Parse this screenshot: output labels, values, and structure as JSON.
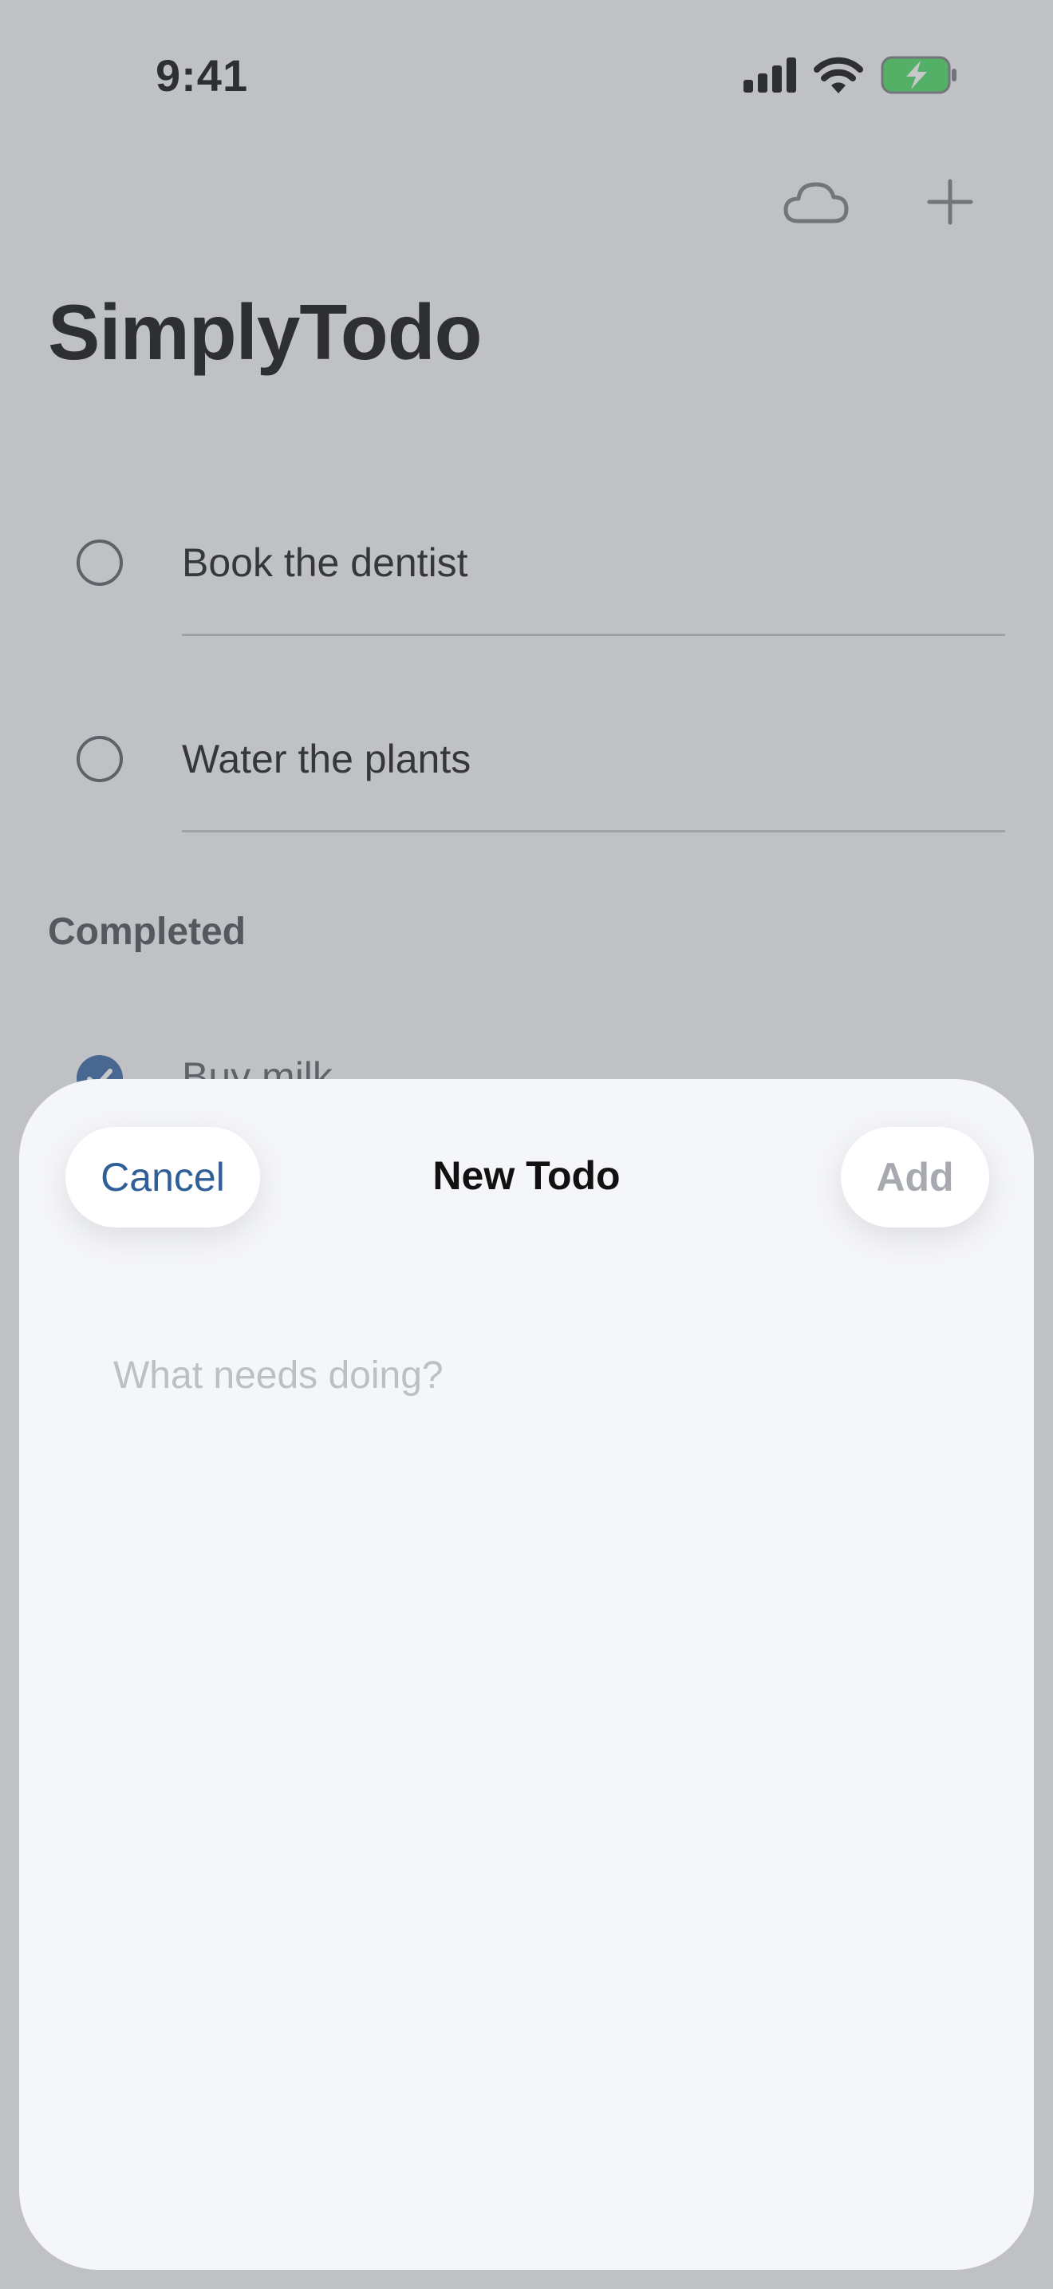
{
  "status_bar": {
    "time": "9:41",
    "icons": [
      "signal-icon",
      "wifi-icon",
      "battery-charging-icon"
    ],
    "battery_color": "#4cd964"
  },
  "toolbar": {
    "icons": [
      "cloud-icon",
      "plus-icon"
    ]
  },
  "app": {
    "title": "SimplyTodo"
  },
  "todos": [
    {
      "label": "Book the dentist",
      "done": false
    },
    {
      "label": "Water the plants",
      "done": false
    }
  ],
  "completed": {
    "header": "Completed",
    "items": [
      {
        "label": "Buy milk",
        "done": true
      }
    ]
  },
  "sheet": {
    "title": "New Todo",
    "cancel_label": "Cancel",
    "add_label": "Add",
    "input_value": "",
    "input_placeholder": "What needs doing?"
  },
  "colors": {
    "accent": "#2f5f96",
    "disabled": "#a6a9ae",
    "check": "#3a6aa6"
  }
}
